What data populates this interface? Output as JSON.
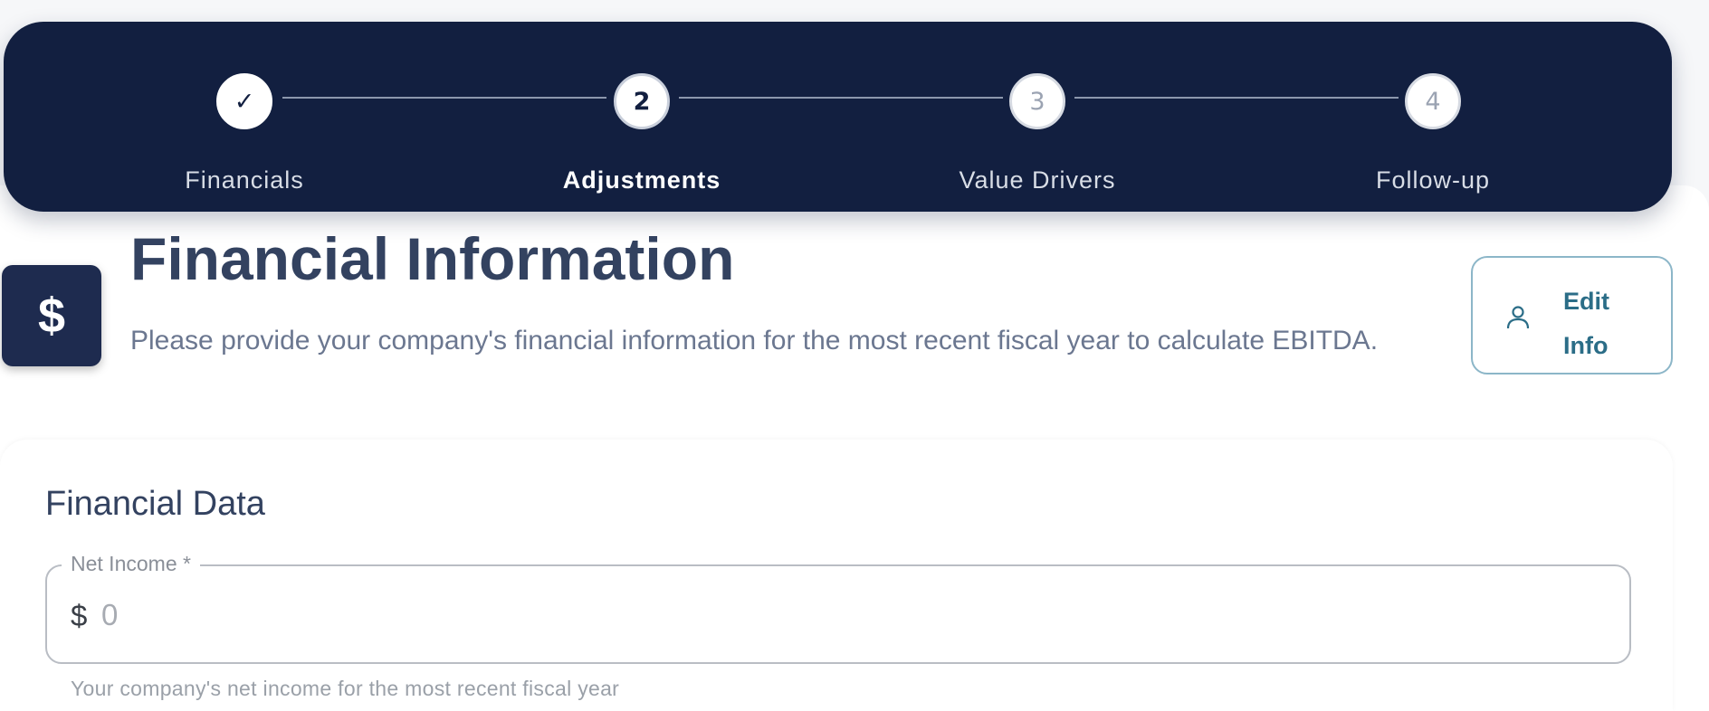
{
  "stepper": {
    "steps": [
      {
        "marker": "✓",
        "label": "Financials",
        "state": "completed"
      },
      {
        "marker": "2",
        "label": "Adjustments",
        "state": "active"
      },
      {
        "marker": "3",
        "label": "Value Drivers",
        "state": "pending"
      },
      {
        "marker": "4",
        "label": "Follow-up",
        "state": "pending"
      }
    ]
  },
  "header": {
    "icon_glyph": "$",
    "icon_name": "dollar-icon",
    "title": "Financial Information",
    "subtitle": "Please provide your company's financial information for the most recent fiscal year to calculate EBITDA."
  },
  "edit_button": {
    "line1": "Edit",
    "line2": "Info",
    "icon_name": "user-icon"
  },
  "financial_data": {
    "section_title": "Financial Data",
    "net_income": {
      "label": "Net Income *",
      "prefix": "$",
      "value": "",
      "placeholder": "0",
      "helper": "Your company's net income for the most recent fiscal year"
    }
  },
  "colors": {
    "stepper_background": "#121f40",
    "title_text": "#334260",
    "accent_teal": "#2b6d87"
  }
}
